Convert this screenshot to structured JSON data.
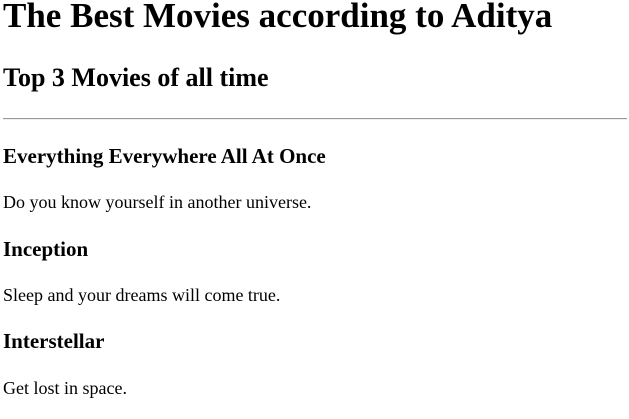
{
  "page": {
    "title": "The Best Movies according to Aditya",
    "subtitle": "Top 3 Movies of all time"
  },
  "movies": [
    {
      "title": "Everything Everywhere All At Once",
      "tagline": "Do you know yourself in another universe."
    },
    {
      "title": "Inception",
      "tagline": "Sleep and your dreams will come true."
    },
    {
      "title": "Interstellar",
      "tagline": "Get lost in space."
    }
  ]
}
